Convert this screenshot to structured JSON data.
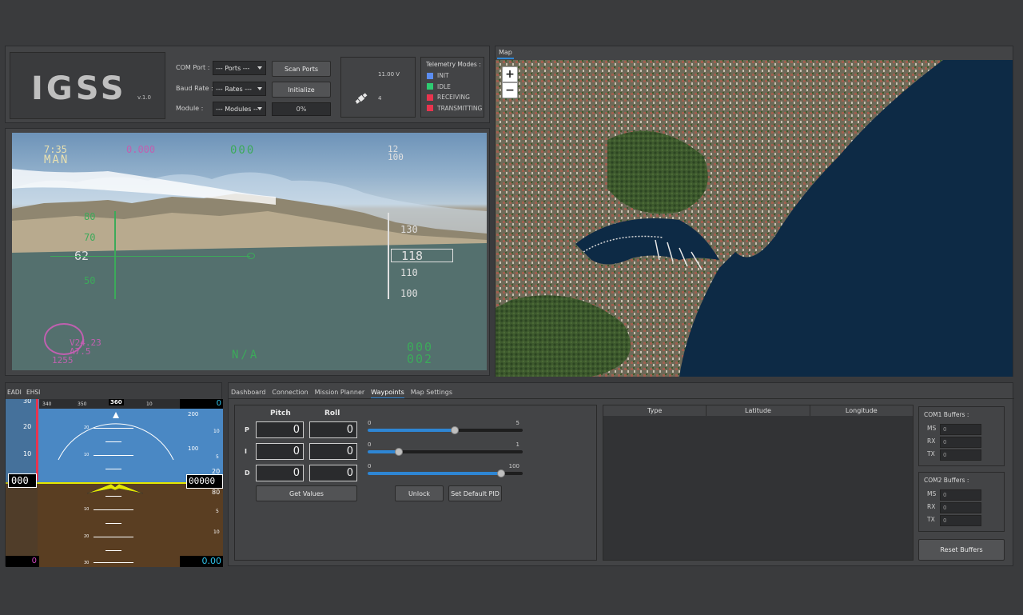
{
  "logo": {
    "title": "IGSS",
    "version": "v.1.0"
  },
  "connection": {
    "com_port_label": "COM Port :",
    "com_port_value": "--- Ports ---",
    "baud_rate_label": "Baud Rate :",
    "baud_rate_value": "--- Rates ---",
    "module_label": "Module :",
    "module_value": "--- Modules --",
    "scan_ports": "Scan Ports",
    "initialize": "Initialize",
    "progress": "0%"
  },
  "status": {
    "voltage": "11.00 V",
    "satellites": "4"
  },
  "telemetry": {
    "title": "Telemetry Modes :",
    "modes": [
      {
        "label": "INIT",
        "color": "#5b8df0"
      },
      {
        "label": "IDLE",
        "color": "#2ecc71"
      },
      {
        "label": "RECEIVING",
        "color": "#e8344e"
      },
      {
        "label": "TRANSMITTING",
        "color": "#e8344e"
      }
    ]
  },
  "hud": {
    "time": "7:35",
    "mode": "MAN",
    "top_value": "0.000",
    "heading_digits": "000",
    "top_right_a": "12",
    "top_right_b": "100",
    "alt_ticks": [
      "80",
      "70",
      "62",
      "50"
    ],
    "speed_ticks": [
      "130",
      "118",
      "110",
      "100"
    ],
    "bottom_left_a": "V24.23",
    "bottom_left_b": "A7.5",
    "bottom_left_c": "1255",
    "bottom_center": "N/A",
    "bottom_right_a": "000",
    "bottom_right_b": "002"
  },
  "map": {
    "tab": "Map",
    "zoom_in": "+",
    "zoom_out": "−",
    "water_color": "#0d2a45",
    "land_color": "#5c6b4a"
  },
  "attitude": {
    "tabs": [
      "EADI",
      "EHSI"
    ],
    "heading_value": "360",
    "heading_ticks": [
      "340",
      "350",
      "10"
    ],
    "left_scale": [
      "30",
      "20",
      "10"
    ],
    "right_scale_top": "0",
    "right_scale": [
      "200",
      "100"
    ],
    "pitch_labels": [
      "20",
      "10",
      "10",
      "20",
      "30"
    ],
    "speed_box": "000",
    "alt_box": "00000",
    "alt_small_a": "20",
    "alt_small_b": "80",
    "bottom_left": "0",
    "bottom_right": "0.00",
    "right_edge": [
      "10",
      "5",
      "5",
      "10"
    ]
  },
  "tabs": [
    "Dashboard",
    "Connection",
    "Mission Planner",
    "Waypoints",
    "Map Settings"
  ],
  "active_tab": "Waypoints",
  "pid": {
    "pitch_header": "Pitch",
    "roll_header": "Roll",
    "rows": [
      {
        "label": "P",
        "pitch": "0",
        "roll": "0",
        "min": "0",
        "max": "5",
        "level": 0.56
      },
      {
        "label": "I",
        "pitch": "0",
        "roll": "0",
        "min": "0",
        "max": "1",
        "level": 0.2
      },
      {
        "label": "D",
        "pitch": "0",
        "roll": "0",
        "min": "0",
        "max": "100",
        "level": 0.86
      }
    ],
    "get_values": "Get Values",
    "unlock": "Unlock",
    "set_default": "Set Default PID"
  },
  "waypoints_table": {
    "columns": [
      "Type",
      "Latitude",
      "Longitude"
    ]
  },
  "com1": {
    "title": "COM1 Buffers :",
    "fields": [
      {
        "label": "MS",
        "value": "0"
      },
      {
        "label": "RX",
        "value": "0"
      },
      {
        "label": "TX",
        "value": "0"
      }
    ]
  },
  "com2": {
    "title": "COM2 Buffers :",
    "fields": [
      {
        "label": "MS",
        "value": "0"
      },
      {
        "label": "RX",
        "value": "0"
      },
      {
        "label": "TX",
        "value": "0"
      }
    ]
  },
  "reset_buffers": "Reset Buffers",
  "colors": {
    "accent": "#2e86d4",
    "sky": "#4a88c4",
    "ground": "#5a3e22",
    "horizon": "#e6e600"
  }
}
